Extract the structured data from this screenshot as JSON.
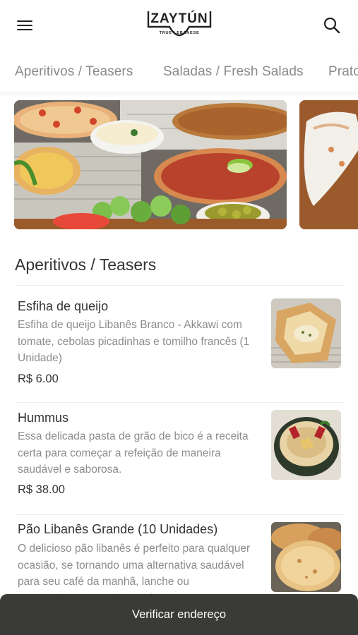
{
  "header": {
    "logo_text": "ZAYTÚN",
    "logo_tagline": "TRUE LEBANESE",
    "menu_icon": "hamburger-menu-icon",
    "search_icon": "search-icon"
  },
  "tabs": [
    {
      "label": "Aperitivos / Teasers"
    },
    {
      "label": "Saladas / Fresh Salads"
    },
    {
      "label": "Prato"
    }
  ],
  "banners": [
    {
      "name": "lebanese-flatbread-banner"
    },
    {
      "name": "wrap-banner"
    }
  ],
  "section": {
    "title": "Aperitivos / Teasers"
  },
  "items": [
    {
      "name": "Esfiha de queijo",
      "description": "Esfiha de queijo Libanês Branco - Akkawi com tomate, cebolas picadinhas e tomilho francês (1 Unidade)",
      "price": "R$ 6.00"
    },
    {
      "name": "Hummus",
      "description": "Essa delicada pasta de grão de bico é a receita certa para começar a refeição de maneira saudável e saborosa.",
      "price": "R$ 38.00"
    },
    {
      "name": "Pão Libanês Grande (10 Unidades)",
      "description": "O delicioso pão libanês é perfeito para qualquer ocasião, se tornando uma alternativa saudável para seu café da manhã, lanche ou acompanhamento de seu almoço.",
      "price": ""
    }
  ],
  "bottom_bar": {
    "label": "Verificar endereço"
  },
  "colors": {
    "bottom_bar": "#3a3a37",
    "muted_text": "#8c8c8c",
    "tab_text": "#8a8a8a"
  }
}
